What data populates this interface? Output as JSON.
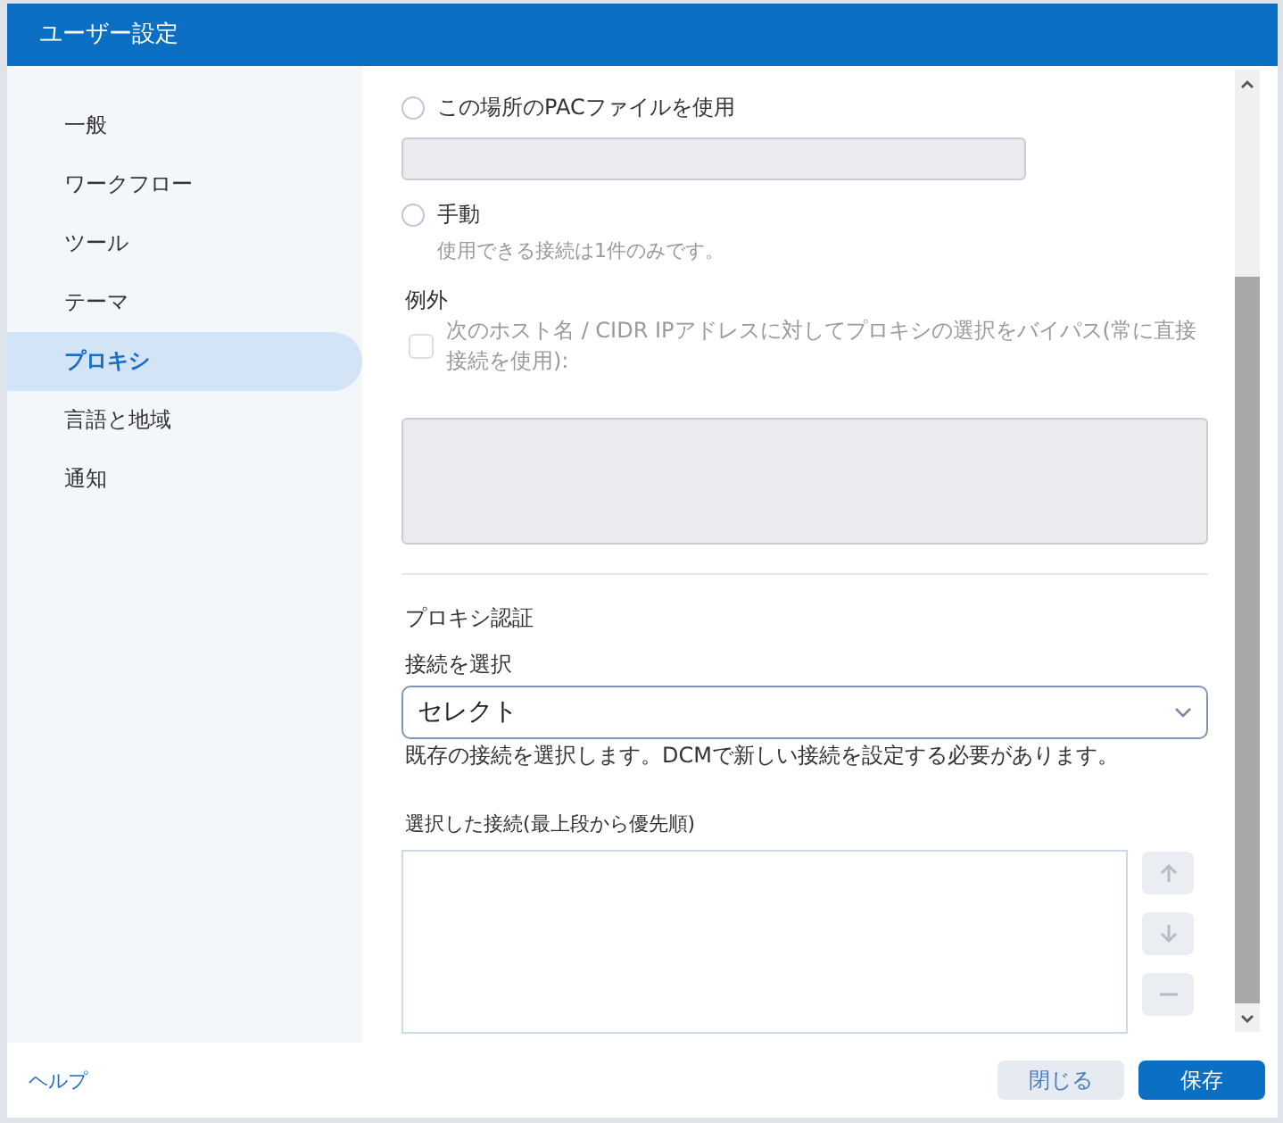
{
  "window": {
    "title": "ユーザー設定"
  },
  "sidebar": {
    "items": [
      {
        "label": "一般",
        "selected": false
      },
      {
        "label": "ワークフロー",
        "selected": false
      },
      {
        "label": "ツール",
        "selected": false
      },
      {
        "label": "テーマ",
        "selected": false
      },
      {
        "label": "プロキシ",
        "selected": true
      },
      {
        "label": "言語と地域",
        "selected": false
      },
      {
        "label": "通知",
        "selected": false
      }
    ]
  },
  "proxy": {
    "pac_option": {
      "label": "この場所のPACファイルを使用",
      "selected": false
    },
    "manual_option": {
      "label": "手動",
      "selected": false,
      "note": "使用できる接続は1件のみです。"
    },
    "exceptions": {
      "heading": "例外",
      "checkbox": {
        "label": "次のホスト名 / CIDR IPアドレスに対してプロキシの選択をバイパス(常に直接接続を使用):",
        "checked": false,
        "disabled": true
      }
    },
    "auth": {
      "heading": "プロキシ認証",
      "select_label": "接続を選択",
      "select_value": "セレクト",
      "hint": "既存の接続を選択します。DCMで新しい接続を設定する必要があります。",
      "list_label": "選択した接続(最上段から優先順)",
      "list_buttons": [
        {
          "kind": "up",
          "disabled": true
        },
        {
          "kind": "down",
          "disabled": true
        },
        {
          "kind": "remove",
          "disabled": true
        }
      ]
    }
  },
  "footer": {
    "help": "ヘルプ",
    "buttons": [
      {
        "label": "閉じる",
        "kind": "secondary"
      },
      {
        "label": "保存",
        "kind": "primary"
      }
    ]
  }
}
